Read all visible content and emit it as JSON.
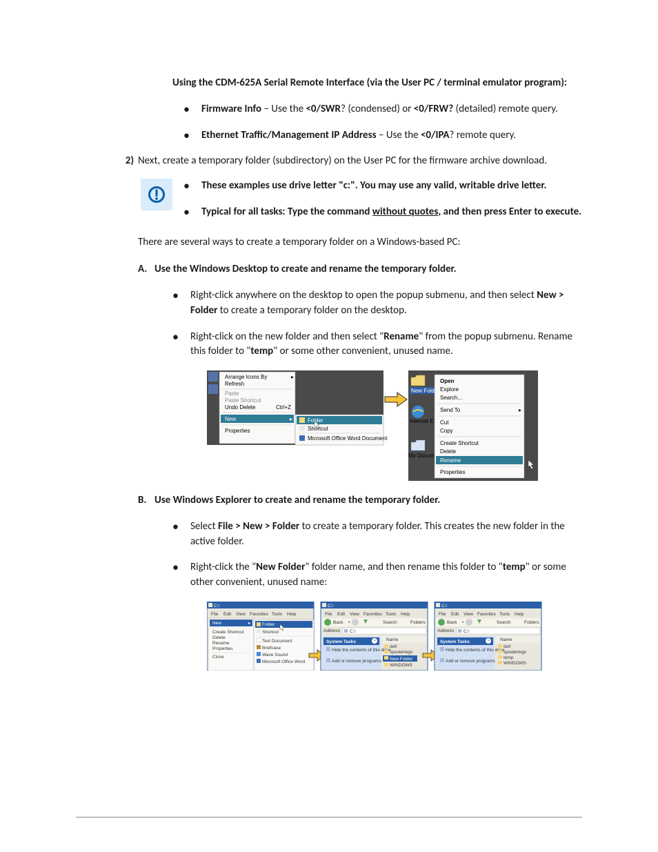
{
  "intro": {
    "heading": "Using the CDM-625A Serial Remote Interface (via the User PC / terminal emulator program):",
    "b1_pre": "Firmware Info",
    "b1_mid1": " – Use the ",
    "b1_cmd1": "<0/SWR",
    "b1_mid2": "? (condensed) or ",
    "b1_cmd2": "<0/FRW?",
    "b1_post": " (detailed) remote query.",
    "b2_pre": "Ethernet Traffic/Management IP Address",
    "b2_mid": " – Use the ",
    "b2_cmd": "<0/IPA",
    "b2_post": "? remote query."
  },
  "step2": {
    "num": "2)",
    "text": "Next, create a temporary folder (subdirectory) on the User PC for the firmware archive download.",
    "note1": "These examples use drive letter \"c:\". You may use any valid, writable drive letter.",
    "note2a": "Typical for all tasks: Type the command ",
    "note2u": "without quotes",
    "note2b": ", and then press Enter to execute.",
    "ways": "There are several ways to create a temporary folder on a Windows-based PC:"
  },
  "A": {
    "letter": "A.",
    "heading": "Use the Windows Desktop to create and rename the temporary folder.",
    "b1a": "Right-click anywhere on the desktop to open the popup submenu, and then select ",
    "b1b": "New > Folder",
    "b1c": " to create a temporary folder on the desktop.",
    "b2a": "Right-click on the new folder and then select \"",
    "b2b": "Rename",
    "b2c": "\" from the popup submenu. Rename this folder to \"",
    "b2d": "temp",
    "b2e": "\" or some other convenient, unused name."
  },
  "B": {
    "letter": "B.",
    "heading": "Use Windows Explorer to create and rename the temporary folder.",
    "b1a": "Select ",
    "b1b": "File > New > Folder",
    "b1c": " to create a temporary folder. This creates the new folder in the active folder.",
    "b2a": "Right-click the \"",
    "b2b": "New Folder",
    "b2c": "\" folder name, and then rename this folder to \"",
    "b2d": "temp",
    "b2e": "\" or some other convenient, unused name:"
  },
  "ctx1": {
    "arrange": "Arrange Icons By",
    "refresh": "Refresh",
    "paste": "Paste",
    "pasteShortcut": "Paste Shortcut",
    "undo": "Undo Delete",
    "undoKey": "Ctrl+Z",
    "new": "New",
    "properties": "Properties",
    "sub_folder": "Folder",
    "sub_shortcut": "Shortcut",
    "sub_word": "Microsoft Office Word Document",
    "newFolder": "New Folder",
    "rc_open": "Open",
    "rc_explore": "Explore",
    "rc_search": "Search...",
    "rc_sendto": "Send To",
    "rc_cut": "Cut",
    "rc_copy": "Copy",
    "rc_createShortcut": "Create Shortcut",
    "rc_delete": "Delete",
    "rc_rename": "Rename",
    "rc_properties": "Properties",
    "internet": "Internet Explorer",
    "mydocs": "My Documents"
  },
  "explorer": {
    "title": "C:\\",
    "menu_file": "File",
    "menu_edit": "Edit",
    "menu_view": "View",
    "menu_fav": "Favorites",
    "menu_tools": "Tools",
    "menu_help": "Help",
    "back": "Back",
    "search": "Search",
    "folders": "Folders",
    "address": "Address",
    "address_val": "C:\\",
    "new": "New",
    "close": "Close",
    "sub_folder": "Folder",
    "sub_shortcut": "Shortcut",
    "sub_text": "Text Document",
    "sub_brief": "Briefcase",
    "sub_wave": "Wave Sound",
    "sub_word": "Microsoft Office Word",
    "systasks": "System Tasks",
    "hide": "Hide the contents of this drive",
    "addremove": "Add or remove programs",
    "name": "Name",
    "f_dell": "dell",
    "f_spool": "spoolerlogs",
    "f_new": "New Folder",
    "f_windows": "WINDOWS",
    "f_temp": "temp"
  }
}
